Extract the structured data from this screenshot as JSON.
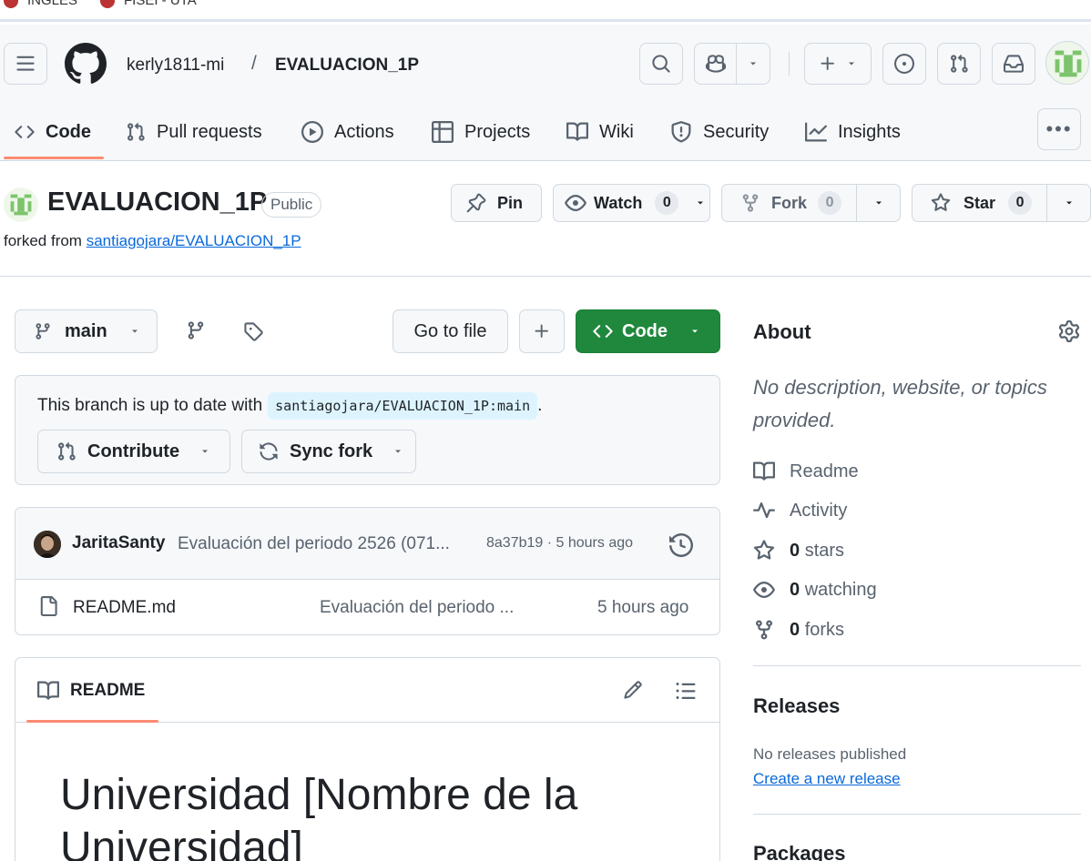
{
  "bookmarks": [
    {
      "label": "INGLES"
    },
    {
      "label": "FISEI - UTA"
    }
  ],
  "header": {
    "owner": "kerly1811-mi",
    "separator": "/",
    "repo": "EVALUACION_1P"
  },
  "tabs": [
    {
      "label": "Code",
      "icon": "code-icon",
      "active": true
    },
    {
      "label": "Pull requests",
      "icon": "git-pull-request-icon"
    },
    {
      "label": "Actions",
      "icon": "play-icon"
    },
    {
      "label": "Projects",
      "icon": "table-icon"
    },
    {
      "label": "Wiki",
      "icon": "book-icon"
    },
    {
      "label": "Security",
      "icon": "shield-icon"
    },
    {
      "label": "Insights",
      "icon": "graph-icon"
    }
  ],
  "repo": {
    "name": "EVALUACION_1P",
    "visibility": "Public",
    "forked_prefix": "forked from",
    "forked_from": "santiagojara/EVALUACION_1P",
    "pin_label": "Pin",
    "watch_label": "Watch",
    "watch_count": "0",
    "fork_label": "Fork",
    "fork_count": "0",
    "star_label": "Star",
    "star_count": "0"
  },
  "toolbar": {
    "branch": "main",
    "go_to_file": "Go to file",
    "add": "+",
    "code_label": "Code"
  },
  "sync": {
    "message": "This branch is up to date with",
    "ref": "santiagojara/EVALUACION_1P:main",
    "period": ".",
    "contribute_label": "Contribute",
    "sync_label": "Sync fork"
  },
  "latest_commit": {
    "author": "JaritaSanty",
    "message": "Evaluación del periodo 2526 (071...",
    "sha_time": "8a37b19 · 5 hours ago"
  },
  "files": [
    {
      "name": "README.md",
      "message": "Evaluación del periodo ...",
      "time": "5 hours ago"
    }
  ],
  "readme": {
    "tab_label": "README",
    "heading": "Universidad [Nombre de la Universidad]"
  },
  "about": {
    "title": "About",
    "description": "No description, website, or topics provided.",
    "readme": "Readme",
    "activity": "Activity",
    "stars_count": "0",
    "stars_label": "stars",
    "watching_count": "0",
    "watching_label": "watching",
    "forks_count": "0",
    "forks_label": "forks"
  },
  "releases": {
    "title": "Releases",
    "empty": "No releases published",
    "create_link": "Create a new release"
  },
  "packages": {
    "title": "Packages"
  },
  "colors": {
    "accent_green": "#1f883d",
    "link_blue": "#0969da",
    "tab_underline": "#fd8c73"
  }
}
